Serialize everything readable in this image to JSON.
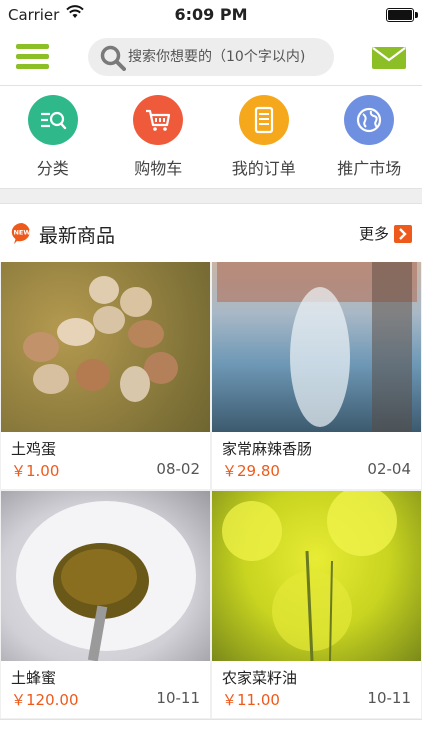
{
  "status_bar": {
    "carrier": "Carrier",
    "time": "6:09 PM"
  },
  "header": {
    "search": {
      "placeholder": "搜索你想要的（10个字以内)"
    }
  },
  "quick_links": [
    {
      "label": "分类",
      "icon": "category-icon",
      "color": "#2fb98a"
    },
    {
      "label": "购物车",
      "icon": "cart-icon",
      "color": "#ef5a3a"
    },
    {
      "label": "我的订单",
      "icon": "order-icon",
      "color": "#f5a81c"
    },
    {
      "label": "推广市场",
      "icon": "globe-icon",
      "color": "#6f8fe0"
    }
  ],
  "section": {
    "title": "最新商品",
    "badge": "NEW",
    "more": "更多"
  },
  "products": [
    {
      "name": "土鸡蛋",
      "price": "￥1.00",
      "date": "08-02"
    },
    {
      "name": "家常麻辣香肠",
      "price": "￥29.80",
      "date": "02-04"
    },
    {
      "name": "土蜂蜜",
      "price": "￥120.00",
      "date": "10-11"
    },
    {
      "name": "农家菜籽油",
      "price": "￥11.00",
      "date": "10-11"
    }
  ],
  "colors": {
    "brand_green": "#8cbf26",
    "accent_orange": "#ee5a1b"
  }
}
